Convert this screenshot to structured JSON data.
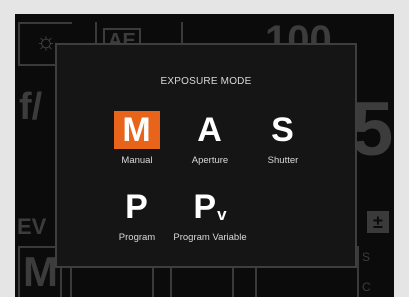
{
  "background": {
    "f_label": "f/",
    "iso_value": "100",
    "aperture_digit": "5",
    "ev_label": "EV",
    "wb_label": "AE",
    "right_letters": [
      "S",
      "C"
    ],
    "mode_letter": "M"
  },
  "dialog": {
    "title": "EXPOSURE MODE",
    "selected_color": "#e8641b",
    "modes": [
      {
        "letter": "M",
        "sub": "",
        "label": "Manual",
        "selected": true
      },
      {
        "letter": "A",
        "sub": "",
        "label": "Aperture",
        "selected": false
      },
      {
        "letter": "S",
        "sub": "",
        "label": "Shutter",
        "selected": false
      },
      {
        "letter": "P",
        "sub": "",
        "label": "Program",
        "selected": false
      },
      {
        "letter": "P",
        "sub": "v",
        "label": "Program Variable",
        "selected": false
      }
    ]
  }
}
